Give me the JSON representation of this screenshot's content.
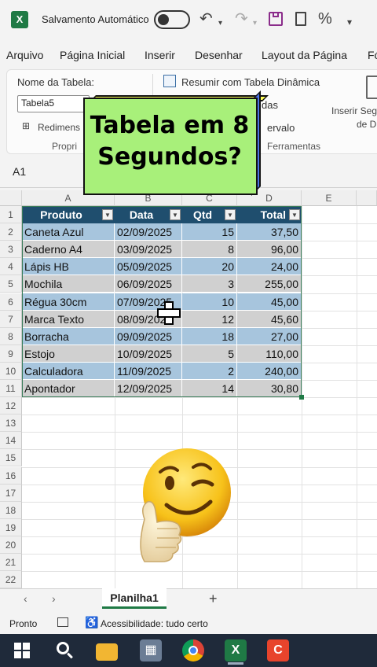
{
  "title_bar": {
    "autosave_label": "Salvamento Automático",
    "undo_icon": "undo-icon",
    "redo_icon": "redo-icon",
    "save_icon": "save-icon",
    "percent_label": "%"
  },
  "menu": [
    "Arquivo",
    "Página Inicial",
    "Inserir",
    "Desenhar",
    "Layout da Página",
    "Fó"
  ],
  "ribbon": {
    "table_name_label": "Nome da Tabela:",
    "table_name_value": "Tabela5",
    "resize_label": "Redimens",
    "properties_group": "Propri",
    "pivot_label": "Resumir com Tabela Dinâmica",
    "duplicates_label": "das",
    "range_label": "ervalo",
    "tools_group": "Ferramentas",
    "slicer_label_1": "Inserir Seg",
    "slicer_label_2": "de D"
  },
  "formula_bar": {
    "name_box": "A1"
  },
  "columns": [
    "A",
    "B",
    "C",
    "D",
    "E"
  ],
  "rows": [
    "1",
    "2",
    "3",
    "4",
    "5",
    "6",
    "7",
    "8",
    "9",
    "10",
    "11",
    "12",
    "13",
    "14",
    "15",
    "16",
    "17",
    "18",
    "19",
    "20",
    "21",
    "22"
  ],
  "table": {
    "headers": [
      "Produto",
      "Data",
      "Qtd",
      "Total"
    ],
    "rows": [
      [
        "Caneta Azul",
        "02/09/2025",
        "15",
        "37,50"
      ],
      [
        "Caderno A4",
        "03/09/2025",
        "8",
        "96,00"
      ],
      [
        "Lápis HB",
        "05/09/2025",
        "20",
        "24,00"
      ],
      [
        "Mochila",
        "06/09/2025",
        "3",
        "255,00"
      ],
      [
        "Régua 30cm",
        "07/09/2025",
        "10",
        "45,00"
      ],
      [
        "Marca Texto",
        "08/09/2025",
        "12",
        "45,60"
      ],
      [
        "Borracha",
        "09/09/2025",
        "18",
        "27,00"
      ],
      [
        "Estojo",
        "10/09/2025",
        "5",
        "110,00"
      ],
      [
        "Calculadora",
        "11/09/2025",
        "2",
        "240,00"
      ],
      [
        "Apontador",
        "12/09/2025",
        "14",
        "30,80"
      ]
    ]
  },
  "popup": {
    "line1": "Tabela em 8",
    "line2": "Segundos?"
  },
  "sheets": {
    "active": "Planilha1",
    "add": "+"
  },
  "status": {
    "ready": "Pronto",
    "accessibility": "Acessibilidade: tudo certo"
  },
  "colors": {
    "header_blue": "#1f4e6e",
    "band_light": "#a7c5dd",
    "band_gray": "#d0d0d0",
    "excel_green": "#1f7a45",
    "popup_green": "#a8f07a"
  }
}
